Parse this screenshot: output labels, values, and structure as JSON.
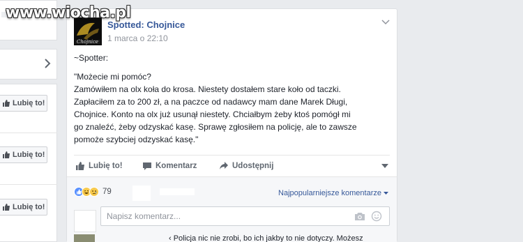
{
  "watermark": "www.wiocha.pl",
  "left_column": {
    "like_buttons": [
      "Lubię to!",
      "Lubię to!",
      "Lubię to!"
    ]
  },
  "post": {
    "page_name": "Spotted: Chojnice",
    "timestamp": "1 marca o 22:10",
    "avatar_label": "Chojnice",
    "author": "~Spotter:",
    "body_lines": [
      "\"Możecie mi pomóc?",
      "Zamówiłem na olx koła do krosa. Niestety dostałem stare koło od taczki.",
      "Zapłaciłem za to 200 zł, a na paczce od nadawcy mam dane Marek Długi,",
      "Chojnice. Konto na olx już usunął niestety. Chciałbym żeby ktoś pomógł mi",
      "go znaleźć, żeby odzyskać kasę. Sprawę zgłosiłem na policję, ale to zawsze",
      "pomoże szybciej odzyskać kasę.\""
    ],
    "actions": {
      "like": "Lubię to!",
      "comment": "Komentarz",
      "share": "Udostępnij"
    },
    "reactions": {
      "count": "79",
      "types": [
        "like-icon",
        "haha-icon",
        "sad-icon"
      ]
    },
    "sort_label": "Najpopularniejsze komentarze",
    "comment_placeholder": "Napisz komentarz...",
    "next_comment_preview": "‹ Policja nic nie zrobi, bo ich jakby to nie dotyczy. Możesz"
  },
  "colors": {
    "link": "#365899",
    "like_blue": "#5890ff",
    "reaction_yellow": "#f7c94c"
  }
}
